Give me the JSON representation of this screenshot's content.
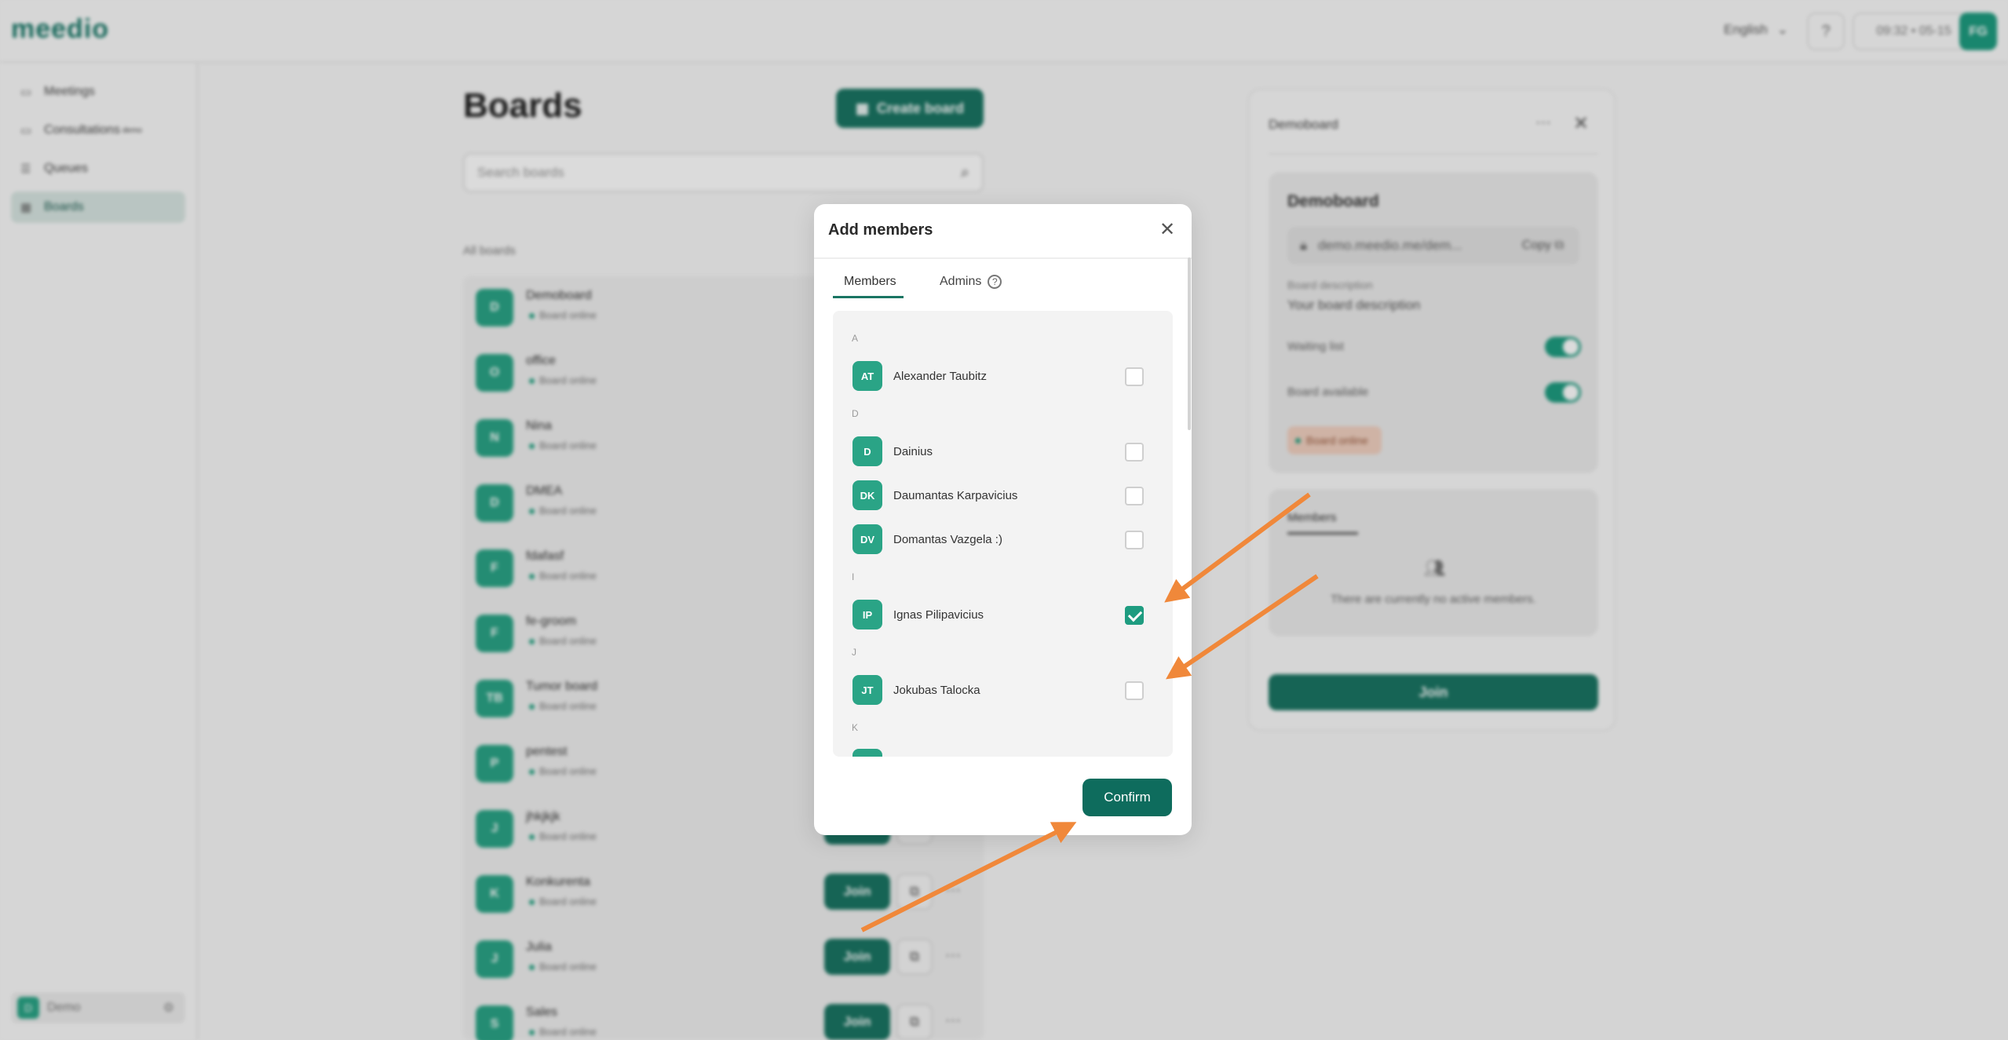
{
  "topbar": {
    "logo": "meedio",
    "language": "English",
    "help_icon": "?",
    "time": "09:32 • 05-15",
    "user_initials": "FG"
  },
  "sidebar": {
    "items": [
      {
        "label": "Meetings",
        "icon": "video-icon"
      },
      {
        "label": "Consultations",
        "badge": "demo",
        "icon": "consultation-icon"
      },
      {
        "label": "Queues",
        "icon": "queue-icon"
      },
      {
        "label": "Boards",
        "icon": "grid-icon",
        "active": true
      }
    ],
    "workspace": {
      "initial": "D",
      "name": "Demo"
    }
  },
  "main": {
    "title": "Boards",
    "create_label": "Create board",
    "search_placeholder": "Search boards",
    "section_label": "All boards",
    "boards": [
      {
        "initials": "D",
        "name": "Demoboard",
        "status": "Board online"
      },
      {
        "initials": "O",
        "name": "office",
        "status": "Board online"
      },
      {
        "initials": "N",
        "name": "Nina",
        "status": "Board online"
      },
      {
        "initials": "D",
        "name": "DMEA",
        "status": "Board online"
      },
      {
        "initials": "F",
        "name": "fdafasf",
        "status": "Board online"
      },
      {
        "initials": "F",
        "name": "fe-groom",
        "status": "Board online"
      },
      {
        "initials": "TB",
        "name": "Tumor board",
        "status": "Board online"
      },
      {
        "initials": "P",
        "name": "pentest",
        "status": "Board online"
      },
      {
        "initials": "J",
        "name": "jhkjkjk",
        "status": "Board online"
      },
      {
        "initials": "K",
        "name": "Konkurenta",
        "status": "Board online"
      },
      {
        "initials": "J",
        "name": "Julia",
        "status": "Board online"
      },
      {
        "initials": "S",
        "name": "Sales",
        "status": "Board online"
      }
    ],
    "join_label": "Join"
  },
  "detail": {
    "header": "Demoboard",
    "title": "Demoboard",
    "link": "demo.meedio.me/dem...",
    "copy_label": "Copy",
    "description_label": "Board description",
    "description_value": "Your board description",
    "waiting_list_label": "Waiting list",
    "board_available_label": "Board available",
    "status": "Board online",
    "members_tab": "Members",
    "empty_text": "There are currently no active members.",
    "join_label": "Join"
  },
  "modal": {
    "title": "Add members",
    "tabs": {
      "members": "Members",
      "admins": "Admins"
    },
    "groups": [
      {
        "letter": "A",
        "members": [
          {
            "initials": "AT",
            "name": "Alexander Taubitz",
            "checked": false
          }
        ]
      },
      {
        "letter": "D",
        "members": [
          {
            "initials": "D",
            "name": "Dainius",
            "checked": false
          },
          {
            "initials": "DK",
            "name": "Daumantas Karpavicius",
            "checked": false
          },
          {
            "initials": "DV",
            "name": "Domantas Vazgela :)",
            "checked": false
          }
        ]
      },
      {
        "letter": "I",
        "members": [
          {
            "initials": "IP",
            "name": "Ignas Pilipavicius",
            "checked": true
          }
        ]
      },
      {
        "letter": "J",
        "members": [
          {
            "initials": "JT",
            "name": "Jokubas Talocka",
            "checked": false
          }
        ]
      },
      {
        "letter": "K",
        "members": []
      }
    ],
    "confirm_label": "Confirm"
  },
  "colors": {
    "brand": "#1a7563",
    "accent": "#1e9c80",
    "arrow": "#f0883a"
  }
}
